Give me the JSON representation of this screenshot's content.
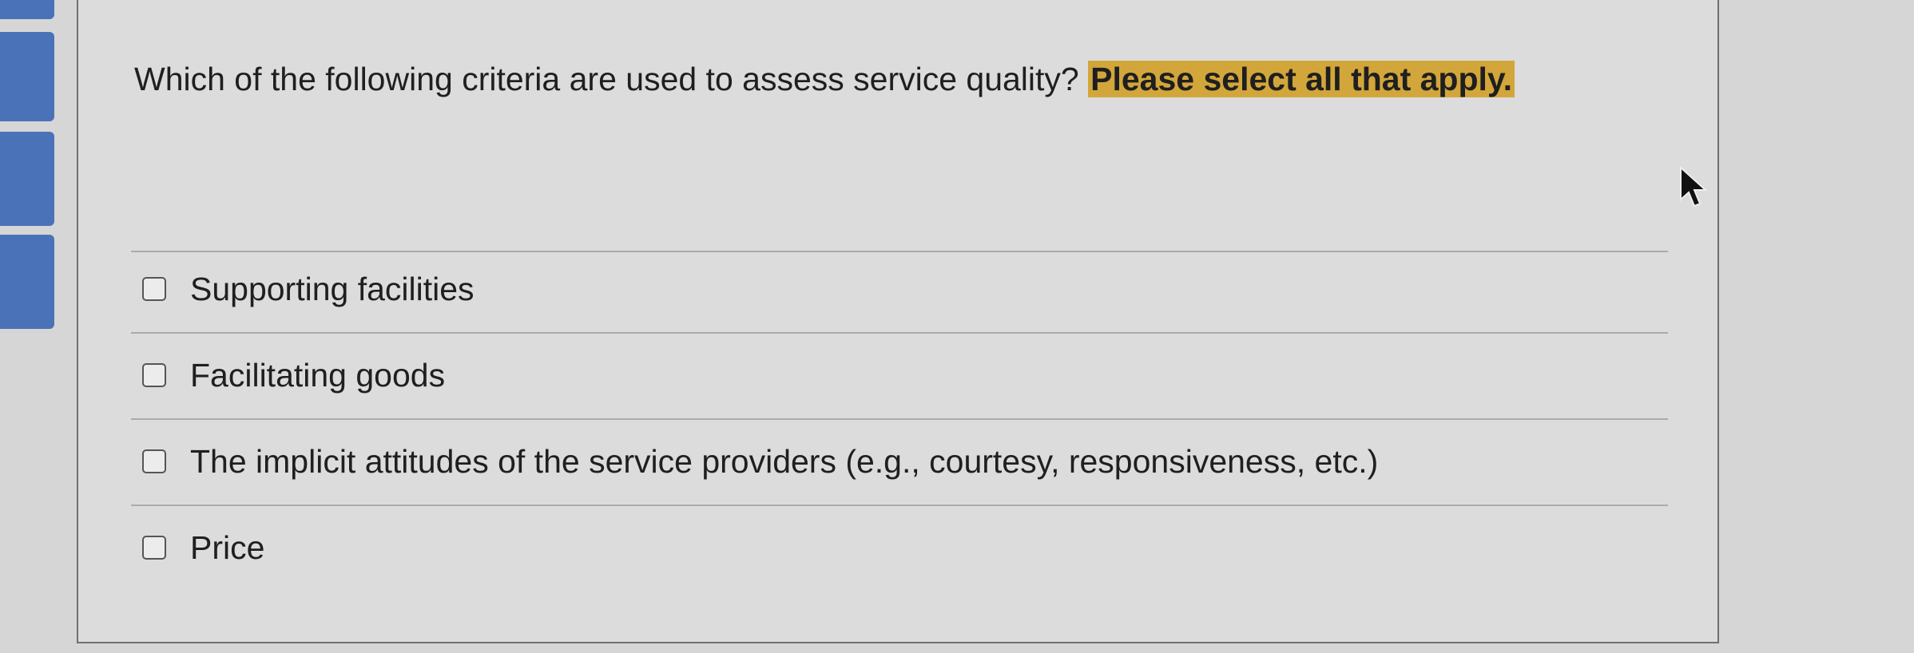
{
  "question": {
    "text": "Which of the following criteria are used to assess service quality?",
    "instruction": "Please select all that apply."
  },
  "options": [
    {
      "label": "Supporting facilities",
      "checked": false
    },
    {
      "label": "Facilitating goods",
      "checked": false
    },
    {
      "label": "The implicit attitudes of the service providers (e.g., courtesy, responsiveness, etc.)",
      "checked": false
    },
    {
      "label": "Price",
      "checked": false
    }
  ],
  "colors": {
    "highlight": "#d2a63a",
    "nav_accent": "#4a72b8",
    "background": "#d6d6d6"
  }
}
